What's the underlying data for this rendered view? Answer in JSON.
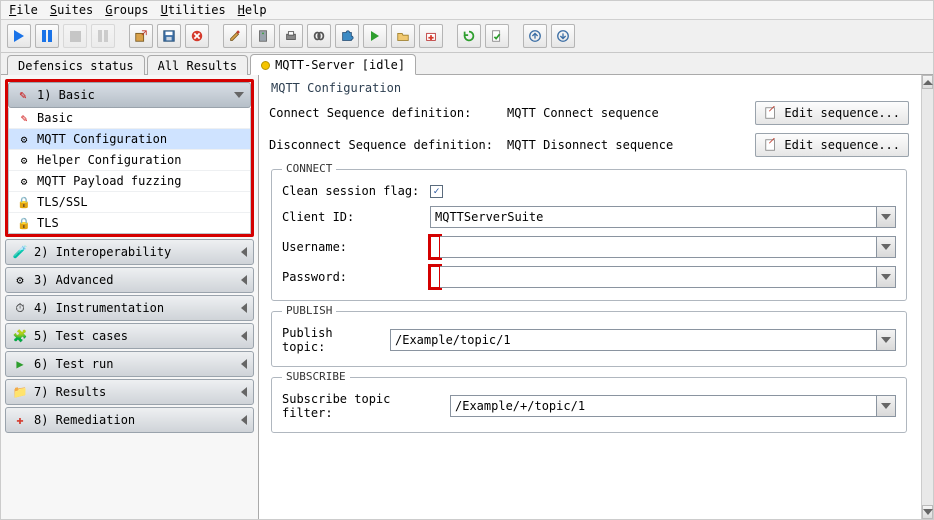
{
  "menu": {
    "file": "File",
    "suites": "Suites",
    "groups": "Groups",
    "utilities": "Utilities",
    "help": "Help"
  },
  "tabs": {
    "t1": "Defensics status",
    "t2": "All Results",
    "t3": "MQTT-Server [idle]"
  },
  "sidebar": {
    "sections": [
      {
        "label": "1) Basic"
      },
      {
        "label": "2) Interoperability"
      },
      {
        "label": "3) Advanced"
      },
      {
        "label": "4) Instrumentation"
      },
      {
        "label": "5) Test cases"
      },
      {
        "label": "6) Test run"
      },
      {
        "label": "7) Results"
      },
      {
        "label": "8) Remediation"
      }
    ],
    "basic_items": [
      {
        "label": "Basic"
      },
      {
        "label": "MQTT Configuration"
      },
      {
        "label": "Helper Configuration"
      },
      {
        "label": "MQTT Payload fuzzing"
      },
      {
        "label": "TLS/SSL"
      },
      {
        "label": "TLS"
      }
    ]
  },
  "panel": {
    "title": "MQTT Configuration",
    "connect_seq_label": "Connect Sequence definition:",
    "connect_seq_value": "MQTT Connect sequence",
    "disconnect_seq_label": "Disconnect Sequence definition:",
    "disconnect_seq_value": "MQTT Disonnect sequence",
    "edit_btn": "Edit sequence...",
    "connect_group": "CONNECT",
    "clean_session_label": "Clean session flag:",
    "clean_session_checked": "✓",
    "client_id_label": "Client ID:",
    "client_id_value": "MQTTServerSuite",
    "username_label": "Username:",
    "username_value": "",
    "password_label": "Password:",
    "password_value": "",
    "publish_group": "PUBLISH",
    "publish_topic_label": "Publish topic:",
    "publish_topic_value": "/Example/topic/1",
    "subscribe_group": "SUBSCRIBE",
    "subscribe_filter_label": "Subscribe topic filter:",
    "subscribe_filter_value": "/Example/+/topic/1"
  }
}
